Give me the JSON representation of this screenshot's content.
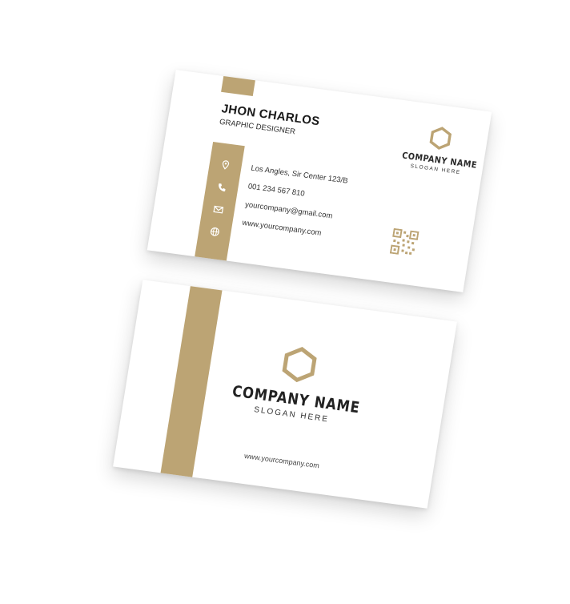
{
  "colors": {
    "gold": "#BCA474",
    "text_dark": "#1a1a1a",
    "card_bg": "#ffffff"
  },
  "front_card": {
    "name": "JHON CHARLOS",
    "role": "GRAPHIC DESIGNER",
    "contacts": [
      {
        "icon": "location-pin-icon",
        "text": "Los Angles, Sir Center 123/B"
      },
      {
        "icon": "phone-icon",
        "text": "001 234 567 810"
      },
      {
        "icon": "envelope-icon",
        "text": "yourcompany@gmail.com"
      },
      {
        "icon": "globe-icon",
        "text": "www.yourcompany.com"
      }
    ],
    "logo_icon": "hexagon-icon",
    "company_name": "COMPANY NAME",
    "slogan": "SLOGAN HERE",
    "qr_icon": "qr-code-icon"
  },
  "back_card": {
    "logo_icon": "hexagon-icon",
    "company_name": "COMPANY NAME",
    "slogan": "SLOGAN HERE",
    "website": "www.yourcompany.com"
  }
}
